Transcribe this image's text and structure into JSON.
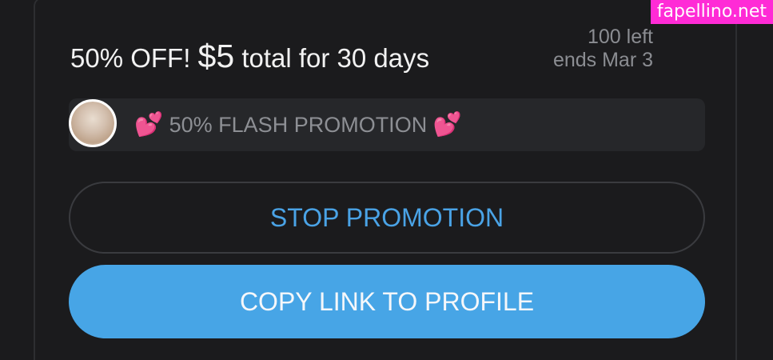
{
  "watermark": {
    "text": "fapellino.net"
  },
  "promo": {
    "headline_prefix": "50% OFF! ",
    "price": "$5",
    "headline_suffix": " total for 30 days",
    "remaining": "100 left",
    "ends": "ends Mar 3",
    "message": "50% FLASH PROMOTION",
    "heart_emoji": "💕"
  },
  "actions": {
    "stop_label": "STOP PROMOTION",
    "copy_label": "COPY LINK TO PROFILE"
  },
  "colors": {
    "background": "#1b1b1d",
    "accent_blue": "#47a5e6",
    "link_blue": "#4aa3e6",
    "watermark_pink": "#ff2bd6"
  }
}
